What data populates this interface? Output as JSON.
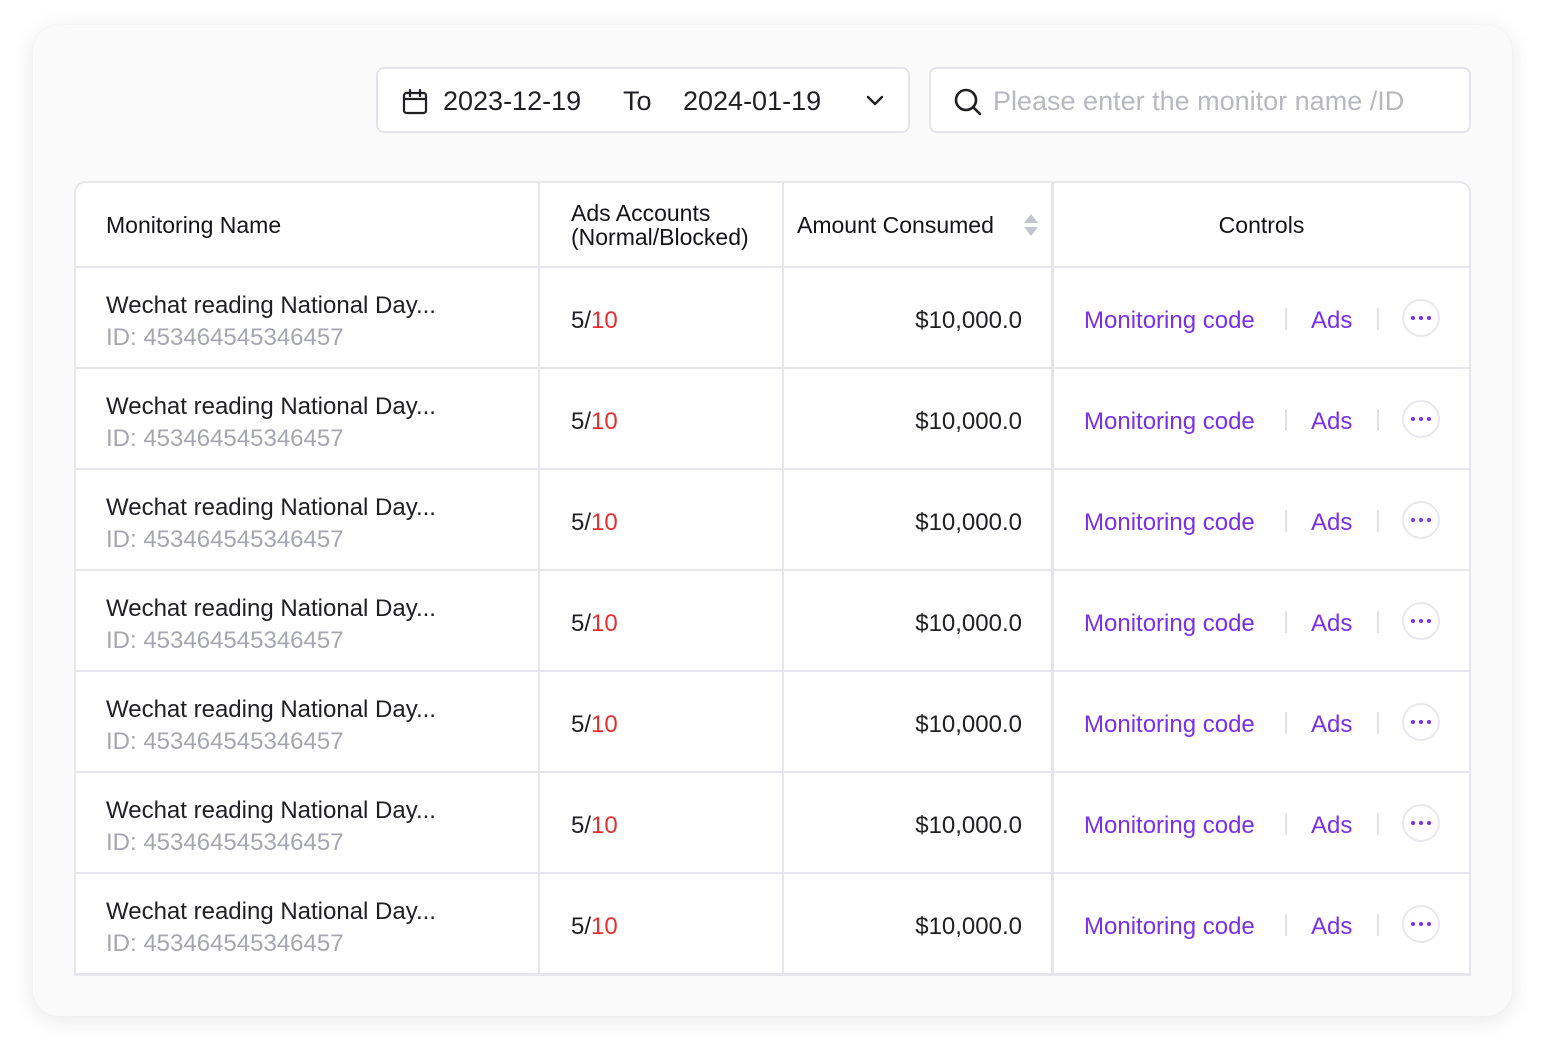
{
  "filters": {
    "date_start": "2023-12-19",
    "date_to_label": "To",
    "date_end": "2024-01-19",
    "search_placeholder": "Please enter the monitor name /ID",
    "search_value": ""
  },
  "table": {
    "headers": {
      "name": "Monitoring Name",
      "accounts_line1": "Ads Accounts",
      "accounts_line2": "(Normal/Blocked)",
      "amount": "Amount Consumed",
      "controls": "Controls"
    },
    "rows": [
      {
        "name": "Wechat reading National Day...",
        "id": "ID: 453464545346457",
        "normal": "5",
        "blocked": "10",
        "amount": "$10,000.0"
      },
      {
        "name": "Wechat reading National Day...",
        "id": "ID: 453464545346457",
        "normal": "5",
        "blocked": "10",
        "amount": "$10,000.0"
      },
      {
        "name": "Wechat reading National Day...",
        "id": "ID: 453464545346457",
        "normal": "5",
        "blocked": "10",
        "amount": "$10,000.0"
      },
      {
        "name": "Wechat reading National Day...",
        "id": "ID: 453464545346457",
        "normal": "5",
        "blocked": "10",
        "amount": "$10,000.0"
      },
      {
        "name": "Wechat reading National Day...",
        "id": "ID: 453464545346457",
        "normal": "5",
        "blocked": "10",
        "amount": "$10,000.0"
      },
      {
        "name": "Wechat reading National Day...",
        "id": "ID: 453464545346457",
        "normal": "5",
        "blocked": "10",
        "amount": "$10,000.0"
      },
      {
        "name": "Wechat reading National Day...",
        "id": "ID: 453464545346457",
        "normal": "5",
        "blocked": "10",
        "amount": "$10,000.0"
      }
    ],
    "controls": {
      "code_label": "Monitoring code",
      "ads_label": "Ads",
      "more_icon": "more-horizontal-icon"
    }
  },
  "colors": {
    "accent": "#7b2fe8",
    "blocked": "#e5302f",
    "muted_text": "#a6a6b0"
  }
}
